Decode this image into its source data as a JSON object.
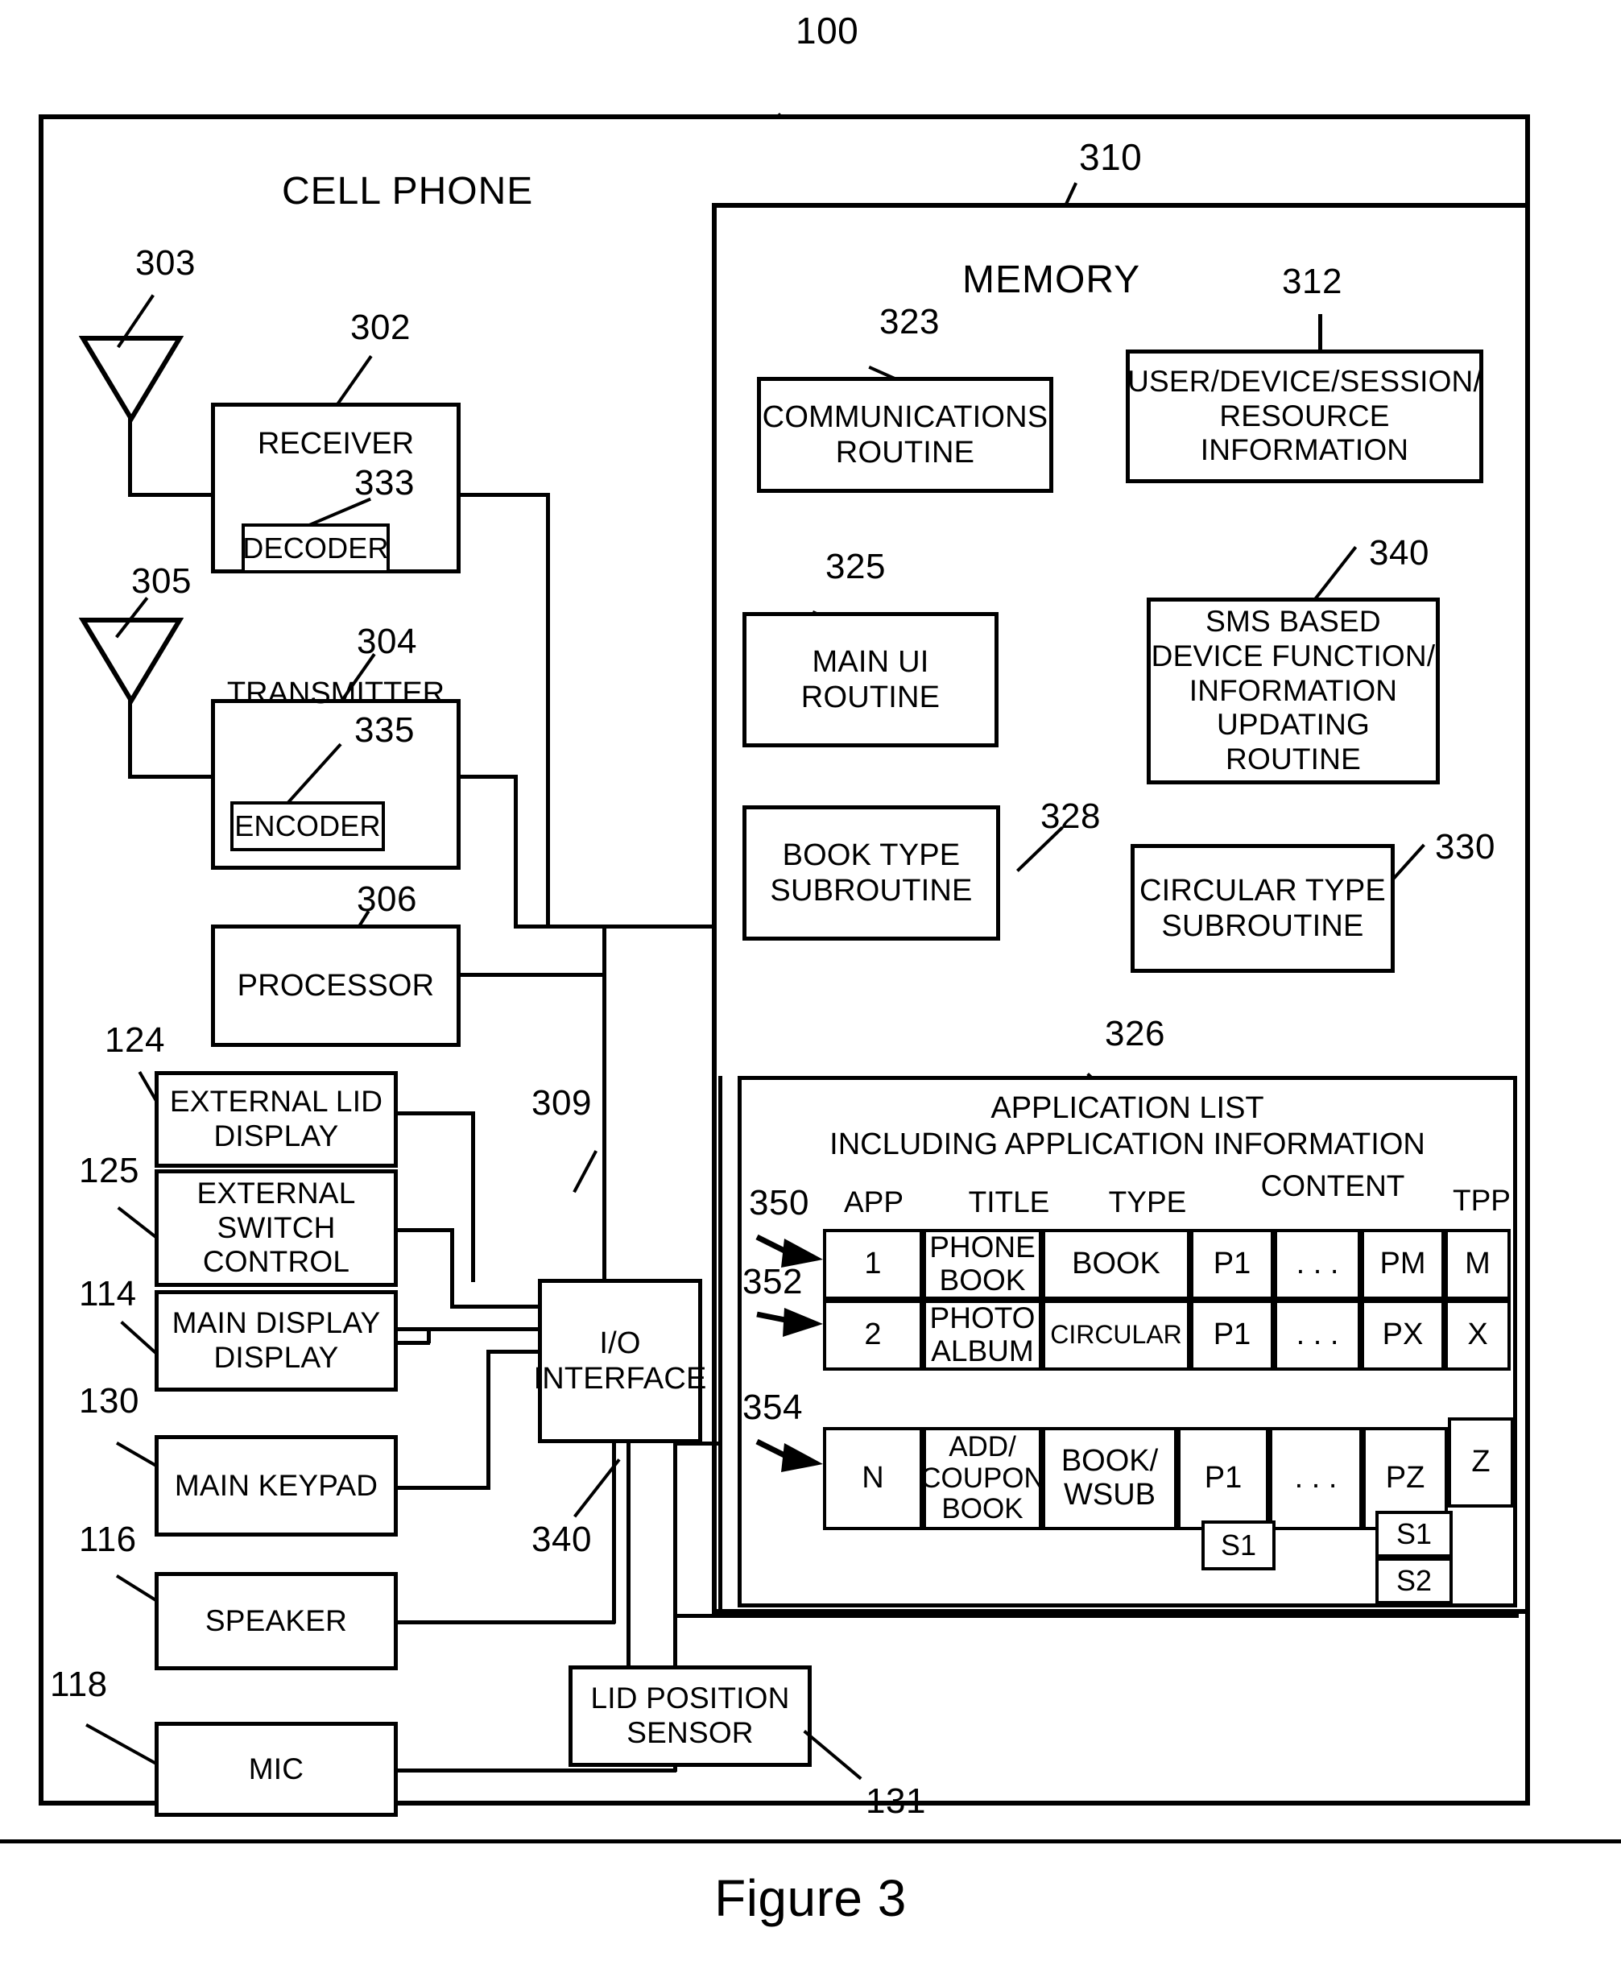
{
  "figure": {
    "caption": "Figure 3",
    "outer_ref": "100",
    "outer_title": "CELL PHONE",
    "memory_ref": "310",
    "memory_title": "MEMORY"
  },
  "radio": {
    "antenna_rx_ref": "303",
    "antenna_tx_ref": "305",
    "receiver_ref": "302",
    "receiver_label": "RECEIVER",
    "decoder_ref": "333",
    "decoder_label": "DECODER",
    "transmitter_ref": "304",
    "transmitter_label": "TRANSMITTER",
    "encoder_ref": "335",
    "encoder_label": "ENCODER",
    "processor_ref": "306",
    "processor_label": "PROCESSOR",
    "bus_ref": "309"
  },
  "peripherals": [
    {
      "ref": "124",
      "label": "EXTERNAL\nLID DISPLAY"
    },
    {
      "ref": "125",
      "label": "EXTERNAL\nSWITCH\nCONTROL"
    },
    {
      "ref": "114",
      "label": "MAIN DISPLAY\nDISPLAY"
    },
    {
      "ref": "130",
      "label": "MAIN KEYPAD"
    },
    {
      "ref": "116",
      "label": "SPEAKER"
    },
    {
      "ref": "118",
      "label": "MIC"
    }
  ],
  "io": {
    "ref": "340",
    "label": "I/O\nINTERFACE"
  },
  "lid_sensor": {
    "ref": "131",
    "label": "LID POSITION\nSENSOR"
  },
  "memory_blocks": [
    {
      "ref": "323",
      "label": "COMMUNICATIONS\nROUTINE"
    },
    {
      "ref": "312",
      "label": "USER/DEVICE/SESSION/\nRESOURCE\nINFORMATION"
    },
    {
      "ref": "325",
      "label": "MAIN UI ROUTINE"
    },
    {
      "ref": "340",
      "label": "SMS BASED\nDEVICE FUNCTION/\nINFORMATION\nUPDATING\nROUTINE"
    },
    {
      "ref": "328",
      "label": "BOOK TYPE\nSUBROUTINE"
    },
    {
      "ref": "330",
      "label": "CIRCULAR TYPE\nSUBROUTINE"
    }
  ],
  "application_list": {
    "ref": "326",
    "title_line1": "APPLICATION LIST",
    "title_line2": "INCLUDING APPLICATION INFORMATION",
    "columns": [
      "APP",
      "TITLE",
      "TYPE",
      "CONTENT",
      "TPP"
    ],
    "row_refs": [
      "350",
      "352",
      "354"
    ],
    "rows": [
      {
        "ref": "350",
        "app": "1",
        "title": "PHONE\nBOOK",
        "type": "BOOK",
        "content": [
          "P1",
          ". . .",
          "PM"
        ],
        "tpp": "M",
        "sub_first": [],
        "sub_last": []
      },
      {
        "ref": "352",
        "app": "2",
        "title": "PHOTO\nALBUM",
        "type": "CIRCULAR",
        "content": [
          "P1",
          ". . .",
          "PX"
        ],
        "tpp": "X",
        "sub_first": [],
        "sub_last": []
      },
      {
        "ref": "354",
        "app": "N",
        "title": "ADD/\nCOUPON\nBOOK",
        "type": "BOOK/\nWSUB",
        "content": [
          "P1",
          ". . .",
          "PZ"
        ],
        "tpp": "Z",
        "sub_first": [
          "S1"
        ],
        "sub_last": [
          "S1",
          "S2"
        ]
      }
    ]
  },
  "colors": {
    "ink": "#000000",
    "paper": "#ffffff"
  }
}
